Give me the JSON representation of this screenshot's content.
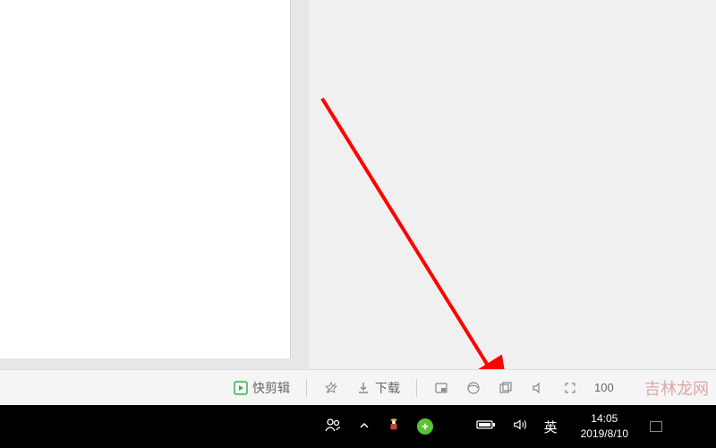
{
  "toolbar": {
    "quick_edit_label": "快剪辑",
    "download_label": "下载",
    "zoom_text": "100"
  },
  "taskbar": {
    "ime_label": "英",
    "time": "14:05",
    "date": "2019/8/10"
  },
  "watermark": "吉林龙网",
  "icons": {
    "play": "play-icon",
    "favorite": "favorite-icon",
    "download": "download-icon",
    "pip": "pip-icon",
    "edge": "edge-icon",
    "windows": "windows-icon",
    "volume_toolbar": "volume-icon",
    "fullscreen": "fullscreen-icon",
    "people": "people-icon",
    "chevron_up": "chevron-up-icon",
    "tray_app": "tray-app-icon",
    "safe360": "360-safe-icon",
    "battery": "battery-icon",
    "speaker": "speaker-icon",
    "notification": "notification-icon"
  }
}
